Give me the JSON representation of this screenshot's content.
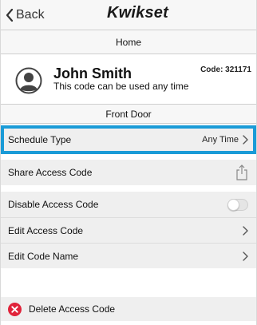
{
  "nav": {
    "back_label": "Back",
    "brand": "Kwikset"
  },
  "home_header": "Home",
  "user": {
    "name": "John Smith",
    "subtitle": "This code can be used any time",
    "code_label": "Code: 321171"
  },
  "door_header": "Front Door",
  "rows": {
    "schedule_type": {
      "label": "Schedule Type",
      "value": "Any Time"
    },
    "share": {
      "label": "Share Access Code"
    },
    "disable": {
      "label": "Disable Access Code",
      "enabled": false
    },
    "edit_code": {
      "label": "Edit Access Code"
    },
    "edit_name": {
      "label": "Edit Code Name"
    },
    "delete": {
      "label": "Delete Access Code"
    }
  },
  "colors": {
    "highlight": "#1a9bd7",
    "delete": "#e0233a"
  },
  "icons": [
    "chevron-left-icon",
    "user-avatar-icon",
    "chevron-right-icon",
    "share-icon",
    "toggle-switch",
    "delete-icon"
  ]
}
